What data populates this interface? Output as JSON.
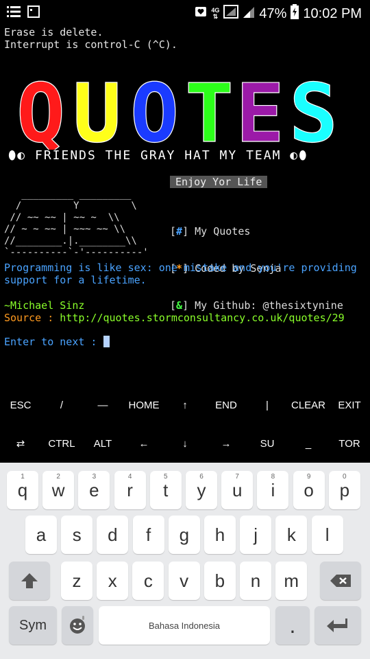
{
  "status": {
    "network": "4G",
    "battery": "47%",
    "time": "10:02 PM"
  },
  "terminal": {
    "line1": "Erase is delete.",
    "line2": "Interrupt is control-C (^C).",
    "banner": {
      "title": "QUOTES",
      "letters": [
        "Q",
        "U",
        "O",
        "T",
        "E",
        "S"
      ],
      "colors": [
        "#ff1a1a",
        "#ffff1a",
        "#1a3bff",
        "#2cff1a",
        "#9b1aa8",
        "#1affff"
      ]
    },
    "tagline": "⬮◐ FRIENDS THE GRAY HAT MY TEAM ◐⬮",
    "enjoy_label": "Enjoy Yor Life",
    "menu": {
      "item1_mark": "#",
      "item1_text": "My Quotes",
      "item2_mark": "*",
      "item2_text": "Coded by Senja",
      "item3_mark": "&",
      "item3_text": "My Github: @thesixtynine"
    },
    "quote": "Programming is like sex: one mistake and you're providing support for a lifetime.",
    "author": "~Michael Sinz",
    "source_label": "Source",
    "source_sep": " : ",
    "source_url": "http://quotes.stormconsultancy.co.uk/quotes/29",
    "prompt": "Enter to next : "
  },
  "extra_keys": {
    "row1": [
      "ESC",
      "/",
      "—",
      "HOME",
      "↑",
      "END",
      "|",
      "CLEAR",
      "EXIT"
    ],
    "row2": [
      "⇄",
      "CTRL",
      "ALT",
      "←",
      "↓",
      "→",
      "SU",
      "_",
      "TOR"
    ]
  },
  "keyboard": {
    "row1": [
      {
        "k": "q",
        "h": "1"
      },
      {
        "k": "w",
        "h": "2"
      },
      {
        "k": "e",
        "h": "3"
      },
      {
        "k": "r",
        "h": "4"
      },
      {
        "k": "t",
        "h": "5"
      },
      {
        "k": "y",
        "h": "6"
      },
      {
        "k": "u",
        "h": "7"
      },
      {
        "k": "i",
        "h": "8"
      },
      {
        "k": "o",
        "h": "9"
      },
      {
        "k": "p",
        "h": "0"
      }
    ],
    "row2": [
      "a",
      "s",
      "d",
      "f",
      "g",
      "h",
      "j",
      "k",
      "l"
    ],
    "row3": [
      "z",
      "x",
      "c",
      "v",
      "b",
      "n",
      "m"
    ],
    "sym_label": "Sym",
    "space_label": "Bahasa Indonesia",
    "period_label": "."
  }
}
